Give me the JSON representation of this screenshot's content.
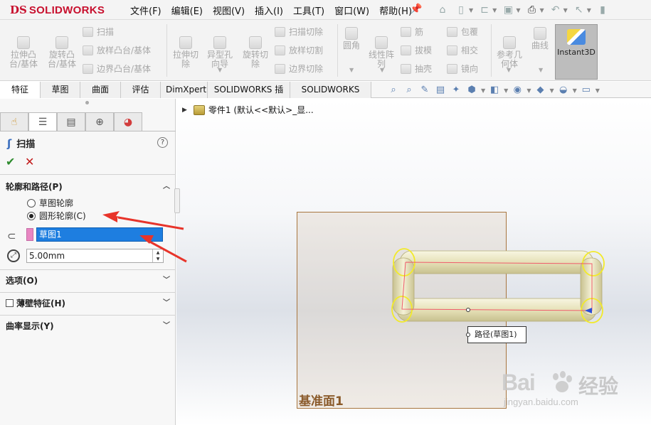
{
  "titlebar": {
    "brand": {
      "ds": "DS",
      "name": "SOLIDWORKS"
    },
    "menus": [
      "文件(F)",
      "编辑(E)",
      "视图(V)",
      "插入(I)",
      "工具(T)",
      "窗口(W)",
      "帮助(H)"
    ]
  },
  "ribbon": {
    "extrude_boss": "拉伸凸\n台/基体",
    "revolve_boss": "旋转凸\n台/基体",
    "sweep": "扫描",
    "loft_boss": "放样凸台/基体",
    "boundary_boss": "边界凸台/基体",
    "extrude_cut": "拉伸切\n除",
    "hole_wizard": "异型孔\n向导",
    "revolve_cut": "旋转切\n除",
    "sweep_cut": "扫描切除",
    "loft_cut": "放样切割",
    "boundary_cut": "边界切除",
    "fillet": "圆角",
    "linear_pattern": "线性阵\n列",
    "rib": "筋",
    "draft": "拔模",
    "shell": "抽壳",
    "wrap": "包覆",
    "intersect": "相交",
    "mirror": "镜向",
    "reference_geometry": "参考几\n何体",
    "curves": "曲线",
    "instant3d": "Instant3D"
  },
  "tabs": [
    "特征",
    "草图",
    "曲面",
    "评估",
    "DimXpert",
    "SOLIDWORKS 插件",
    "SOLIDWORKS MBD"
  ],
  "tree": {
    "part": "零件1 (默认<<默认>_显..."
  },
  "property_manager": {
    "title": "扫描",
    "section_profile_path": "轮廓和路径(P)",
    "radio_sketch_profile": "草图轮廓",
    "radio_circular_profile": "圆形轮廓(C)",
    "path_value": "草图1",
    "diameter_value": "5.00mm",
    "section_options": "选项(O)",
    "section_thin": "薄壁特征(H)",
    "section_curvature": "曲率显示(Y)"
  },
  "viewport": {
    "plane_label": "基准面1",
    "path_callout": "路径(草图1)"
  },
  "watermark": {
    "main": "Bai",
    "cn": "经验",
    "site": "jingyan.baidu.com"
  },
  "colors": {
    "brand_red": "#c8102e",
    "selection_blue": "#1e7ee0",
    "annotation_red": "#e8342a",
    "plane_border": "#a8753e",
    "tube_fill": "#ece9c8",
    "profile_yellow": "#f2ea2a"
  }
}
